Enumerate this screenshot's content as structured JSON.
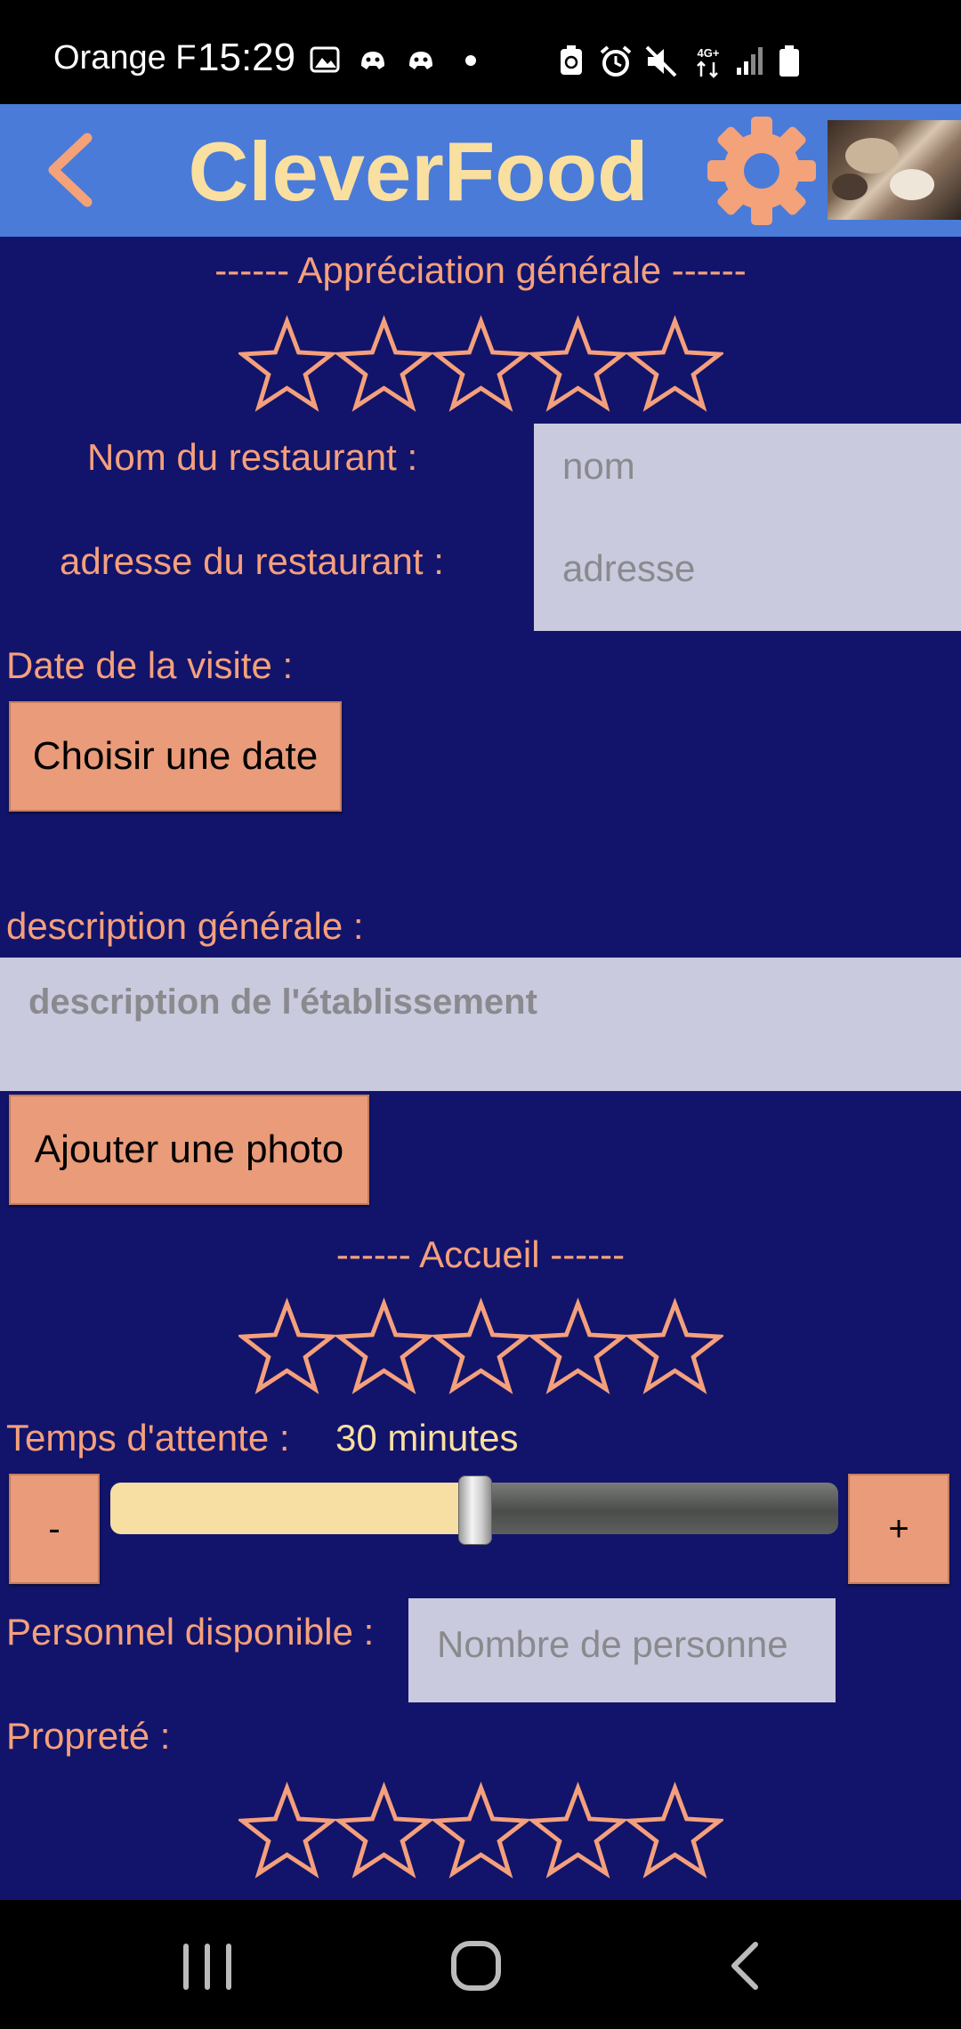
{
  "status_bar": {
    "carrier": "Orange F",
    "time": "15:29",
    "network": "4G+"
  },
  "app_bar": {
    "title": "CleverFood",
    "back_icon": "chevron-left-icon",
    "settings_icon": "gear-icon",
    "avatar": "cat-photo-avatar"
  },
  "colors": {
    "app_bar": "#4a7bd8",
    "background": "#12146b",
    "title": "#f9dfa0",
    "accent": "#f5a07c",
    "button": "#e99b7a",
    "input_bg": "#c9cade",
    "slider_fill": "#f7dea3"
  },
  "form": {
    "general_rating": {
      "title": "------ Appréciation générale ------",
      "stars_filled": 0,
      "stars_total": 5
    },
    "restaurant_name": {
      "label": "Nom du restaurant :",
      "placeholder": "nom"
    },
    "restaurant_address": {
      "label": "adresse du restaurant :",
      "placeholder": "adresse"
    },
    "visit_date": {
      "label": "Date de la visite :",
      "button": "Choisir une date"
    },
    "description": {
      "label": "description générale :",
      "placeholder": "description de l'établissement"
    },
    "add_photo_button": "Ajouter une photo",
    "welcome_rating": {
      "title": "------ Accueil ------",
      "stars_filled": 0,
      "stars_total": 5
    },
    "wait_time": {
      "label": "Temps d'attente :",
      "value_text": "30 minutes",
      "slider_fraction": 0.5,
      "minus": "-",
      "plus": "+"
    },
    "staff": {
      "label": "Personnel disponible :",
      "placeholder": "Nombre de personne"
    },
    "cleanliness": {
      "label": "Propreté :",
      "stars_filled": 0,
      "stars_total": 5
    }
  },
  "nav_bar": {
    "recents_icon": "recents-icon",
    "home_icon": "home-icon",
    "back_icon": "back-icon"
  }
}
